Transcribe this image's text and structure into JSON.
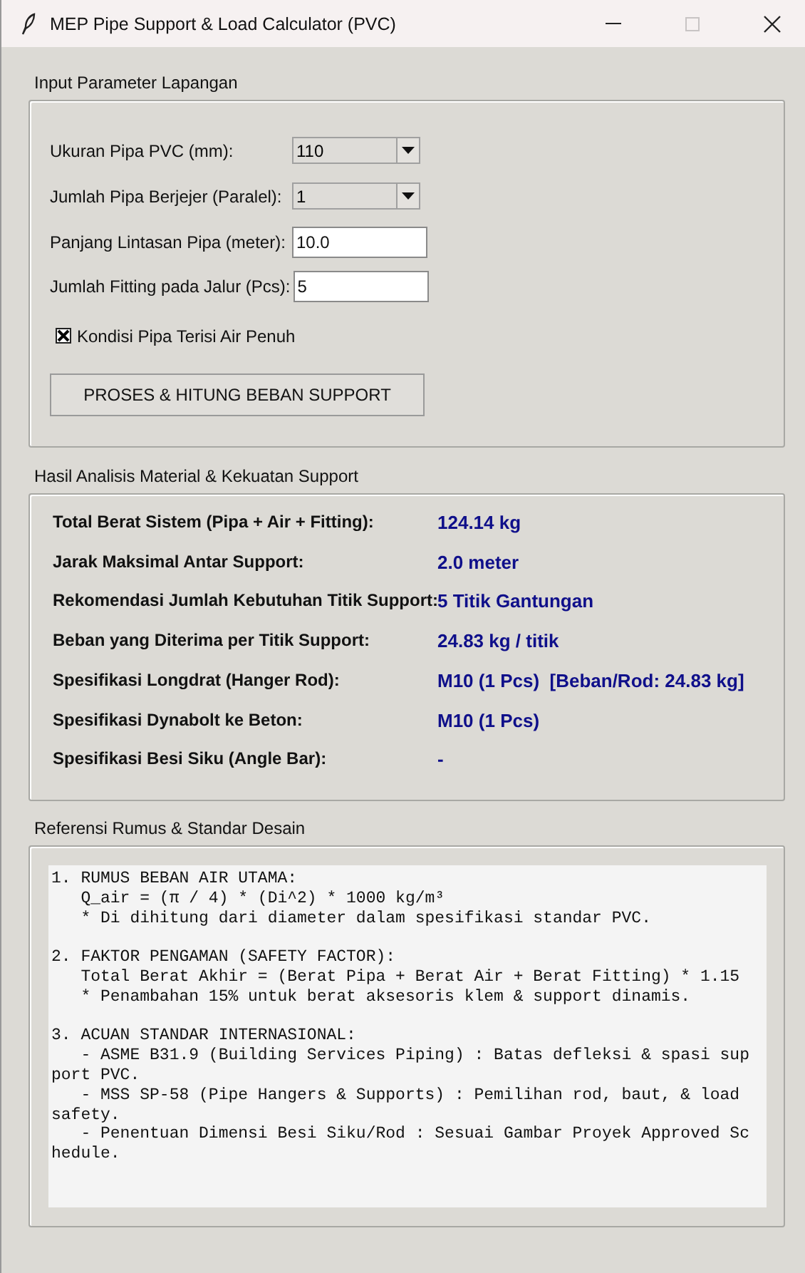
{
  "window": {
    "title": "MEP Pipe Support & Load Calculator (PVC)"
  },
  "input_section": {
    "title": "Input Parameter Lapangan",
    "fields": [
      {
        "kind": "dropdown",
        "label": "Ukuran Pipa PVC (mm):",
        "value": "110"
      },
      {
        "kind": "dropdown",
        "label": "Jumlah Pipa Berjejer (Paralel):",
        "value": "1"
      },
      {
        "kind": "entry",
        "label": "Panjang Lintasan Pipa (meter):",
        "value": "10.0"
      },
      {
        "kind": "entry",
        "label": "Jumlah Fitting pada Jalur (Pcs):",
        "value": "5"
      }
    ],
    "checkbox": {
      "label": "Kondisi Pipa Terisi Air Penuh",
      "checked": true
    },
    "button": "PROSES & HITUNG BEBAN SUPPORT"
  },
  "results_section": {
    "title": "Hasil Analisis Material & Kekuatan Support",
    "rows": [
      {
        "label": "Total Berat Sistem (Pipa + Air + Fitting):",
        "value": "124.14 kg"
      },
      {
        "label": "Jarak Maksimal Antar Support:",
        "value": "2.0 meter"
      },
      {
        "label": "Rekomendasi Jumlah Kebutuhan Titik Support:",
        "value": "5 Titik Gantungan"
      },
      {
        "label": "Beban yang Diterima per Titik Support:",
        "value": "24.83 kg / titik"
      },
      {
        "label": "Spesifikasi Longdrat (Hanger Rod):",
        "value": "M10 (1 Pcs)  [Beban/Rod: 24.83 kg]"
      },
      {
        "label": "Spesifikasi Dynabolt ke Beton:",
        "value": "M10 (1 Pcs)"
      },
      {
        "label": "Spesifikasi Besi Siku (Angle Bar):",
        "value": "-"
      }
    ]
  },
  "reference_section": {
    "title": "Referensi Rumus & Standar Desain",
    "blocks": [
      [
        "1. RUMUS BEBAN AIR UTAMA:",
        "   Q_air = (π / 4) * (Di^2) * 1000 kg/m³",
        "   * Di dihitung dari diameter dalam spesifikasi standar PVC."
      ],
      [
        "2. FAKTOR PENGAMAN (SAFETY FACTOR):",
        "   Total Berat Akhir = (Berat Pipa + Berat Air + Berat Fitting) * 1.15",
        "   * Penambahan 15% untuk berat aksesoris klem & support dinamis."
      ],
      [
        "3. ACUAN STANDAR INTERNASIONAL:",
        "   - ASME B31.9 (Building Services Piping) : Batas defleksi & spasi sup",
        "port PVC.",
        "   - MSS SP-58 (Pipe Hangers & Supports) : Pemilihan rod, baut, & load",
        "safety.",
        "   - Penentuan Dimensi Besi Siku/Rod : Sesuai Gambar Proyek Approved Sc",
        "hedule."
      ]
    ]
  }
}
